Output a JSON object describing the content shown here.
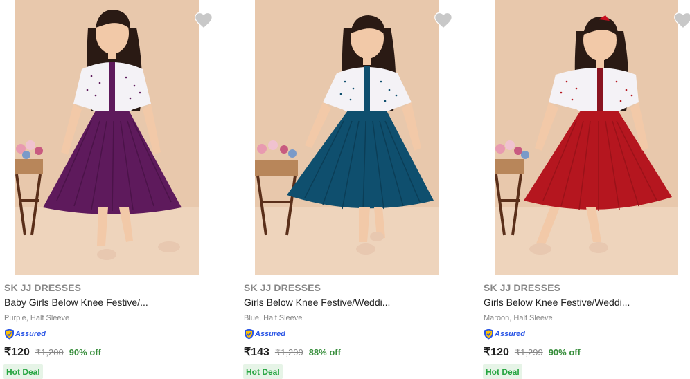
{
  "products": [
    {
      "brand": "SK JJ DRESSES",
      "title": "Baby Girls Below Knee Festive/...",
      "variant": "Purple, Half Sleeve",
      "assured_label": "Assured",
      "price": "₹120",
      "mrp": "₹1,200",
      "discount": "90% off",
      "deal_badge": "Hot Deal",
      "dress_color": "#5e1a5c",
      "accent_color": "#5a1a55"
    },
    {
      "brand": "SK JJ DRESSES",
      "title": "Girls Below Knee Festive/Weddi...",
      "variant": "Blue, Half Sleeve",
      "assured_label": "Assured",
      "price": "₹143",
      "mrp": "₹1,299",
      "discount": "88% off",
      "deal_badge": "Hot Deal",
      "dress_color": "#0f4f6e",
      "accent_color": "#0e5870"
    },
    {
      "brand": "SK JJ DRESSES",
      "title": "Girls Below Knee Festive/Weddi...",
      "variant": "Maroon, Half Sleeve",
      "assured_label": "Assured",
      "price": "₹120",
      "mrp": "₹1,299",
      "discount": "90% off",
      "deal_badge": "Hot Deal",
      "dress_color": "#b5161f",
      "accent_color": "#8a1320"
    }
  ],
  "icons": {
    "wishlist": "heart-icon",
    "assured": "shield-icon"
  },
  "colors": {
    "backdrop": "#e8c8ac",
    "heart": "#c8c8c8",
    "discount_green": "#388e3c",
    "deal_bg": "#e6f4e7",
    "assured_blue": "#2a55e5"
  }
}
